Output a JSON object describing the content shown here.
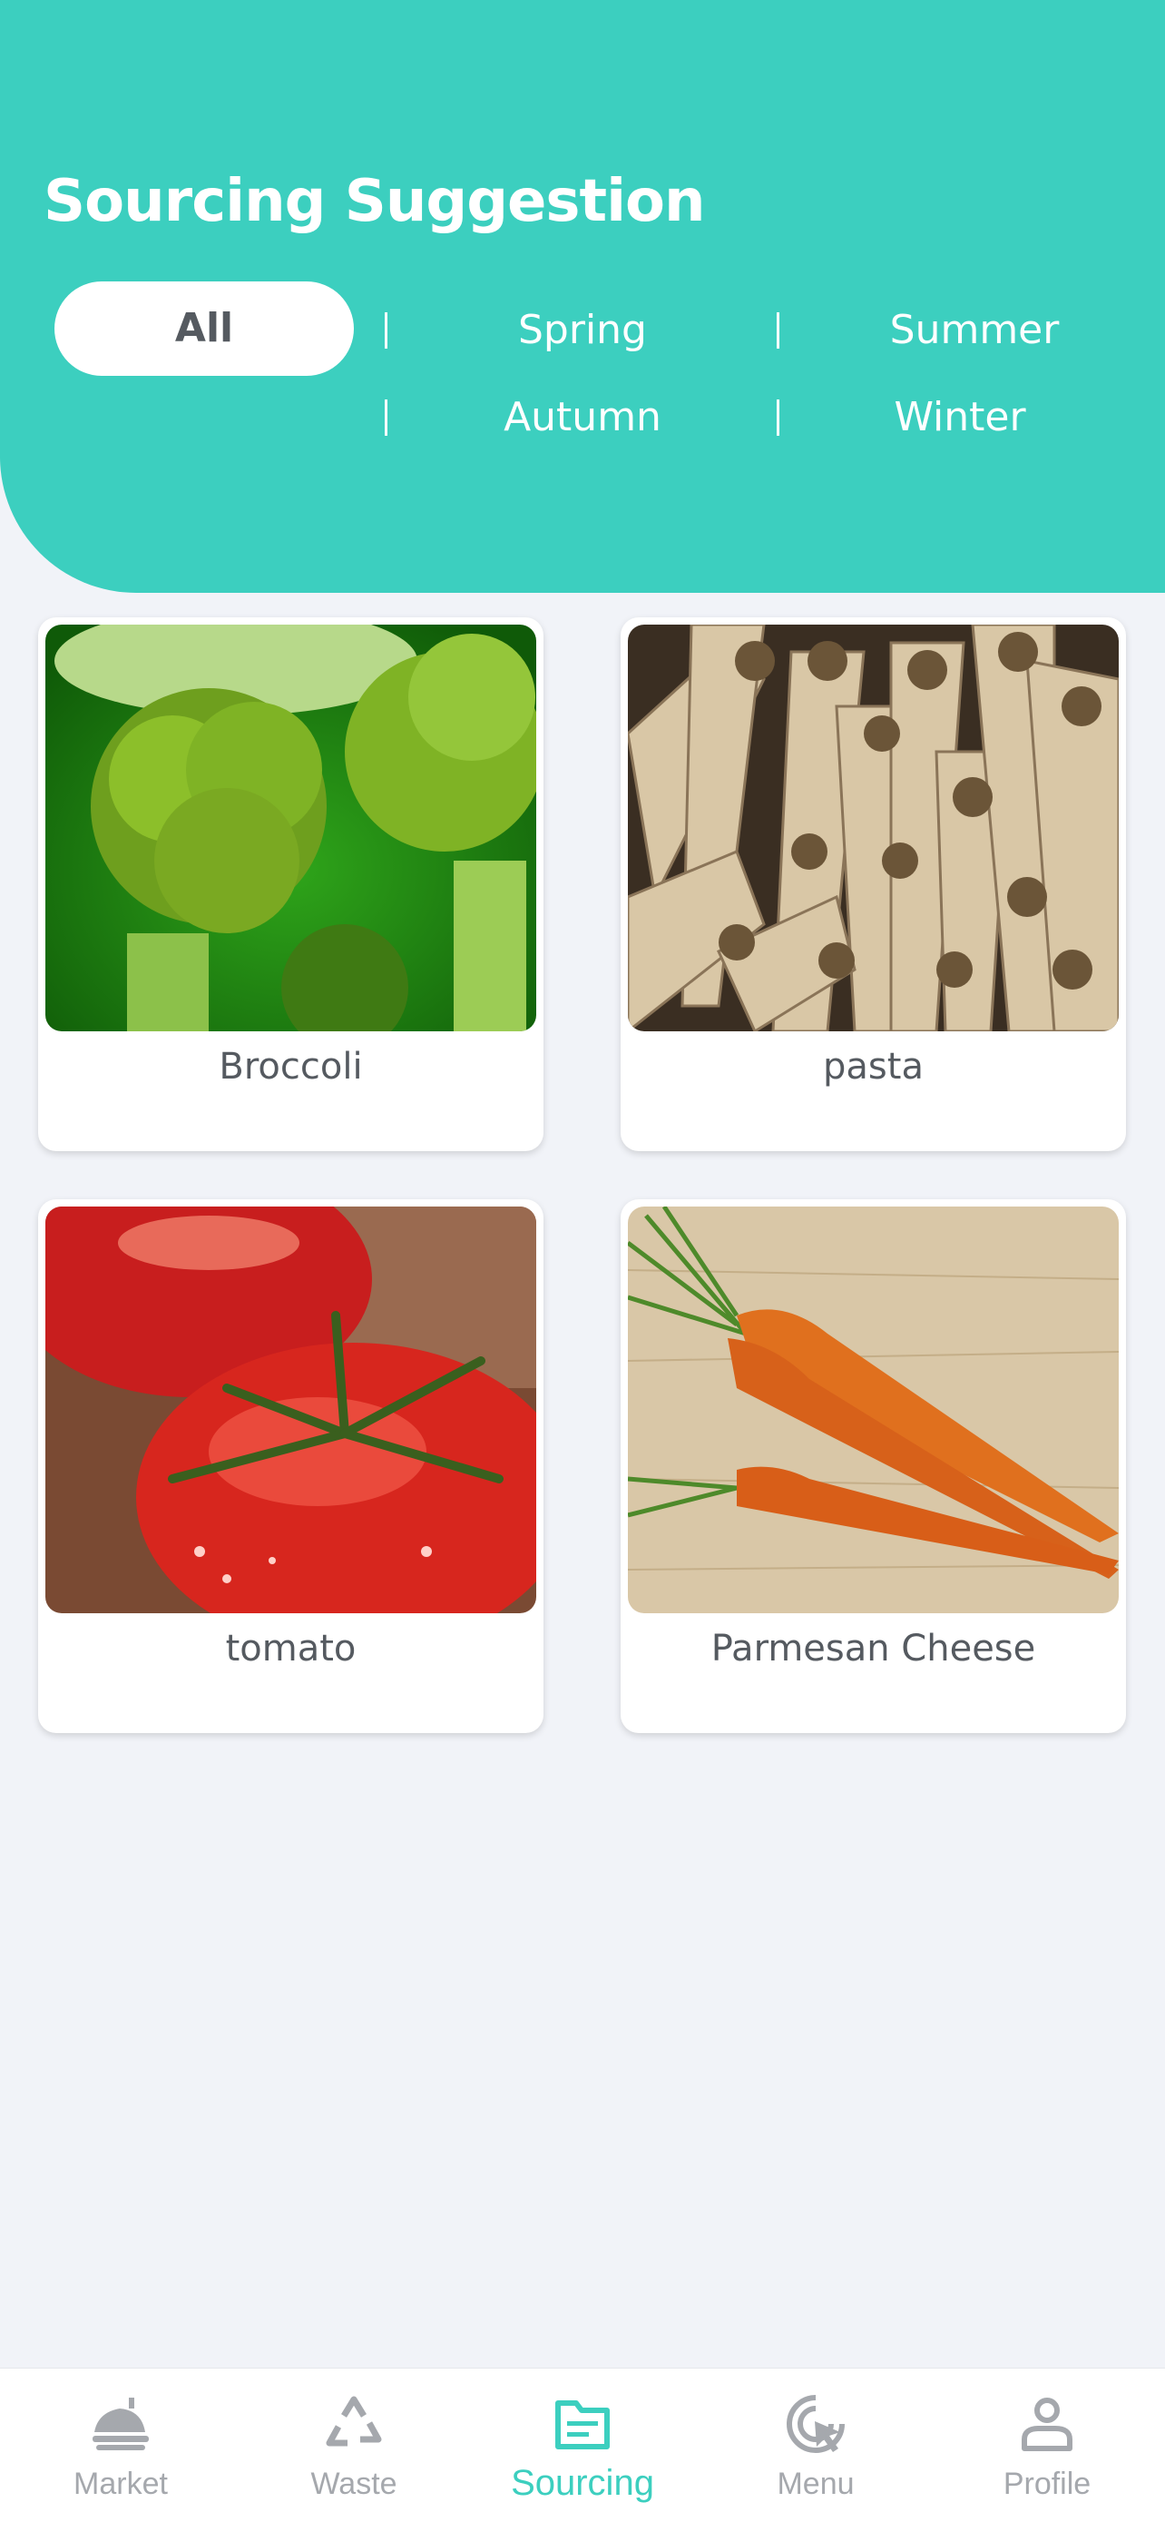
{
  "header": {
    "title": "Sourcing Suggestion",
    "filters": [
      {
        "label": "All",
        "active": true
      },
      {
        "label": "Spring",
        "active": false
      },
      {
        "label": "Summer",
        "active": false
      },
      {
        "label": "Autumn",
        "active": false
      },
      {
        "label": "Winter",
        "active": false
      }
    ]
  },
  "items": [
    {
      "label": "Broccoli",
      "image": "broccoli-photo"
    },
    {
      "label": "pasta",
      "image": "parsnips-photo"
    },
    {
      "label": "tomato",
      "image": "tomato-photo"
    },
    {
      "label": "Parmesan Cheese",
      "image": "carrots-photo"
    }
  ],
  "nav": [
    {
      "label": "Market",
      "icon": "food-tray-icon",
      "active": false
    },
    {
      "label": "Waste",
      "icon": "recycle-icon",
      "active": false
    },
    {
      "label": "Sourcing",
      "icon": "folder-icon",
      "active": true
    },
    {
      "label": "Menu",
      "icon": "click-cursor-icon",
      "active": false
    },
    {
      "label": "Profile",
      "icon": "person-icon",
      "active": false
    }
  ],
  "colors": {
    "accent": "#3ccfbf",
    "background": "#f1f3f8",
    "text": "#555a60",
    "inactive": "#a5a8ad"
  }
}
